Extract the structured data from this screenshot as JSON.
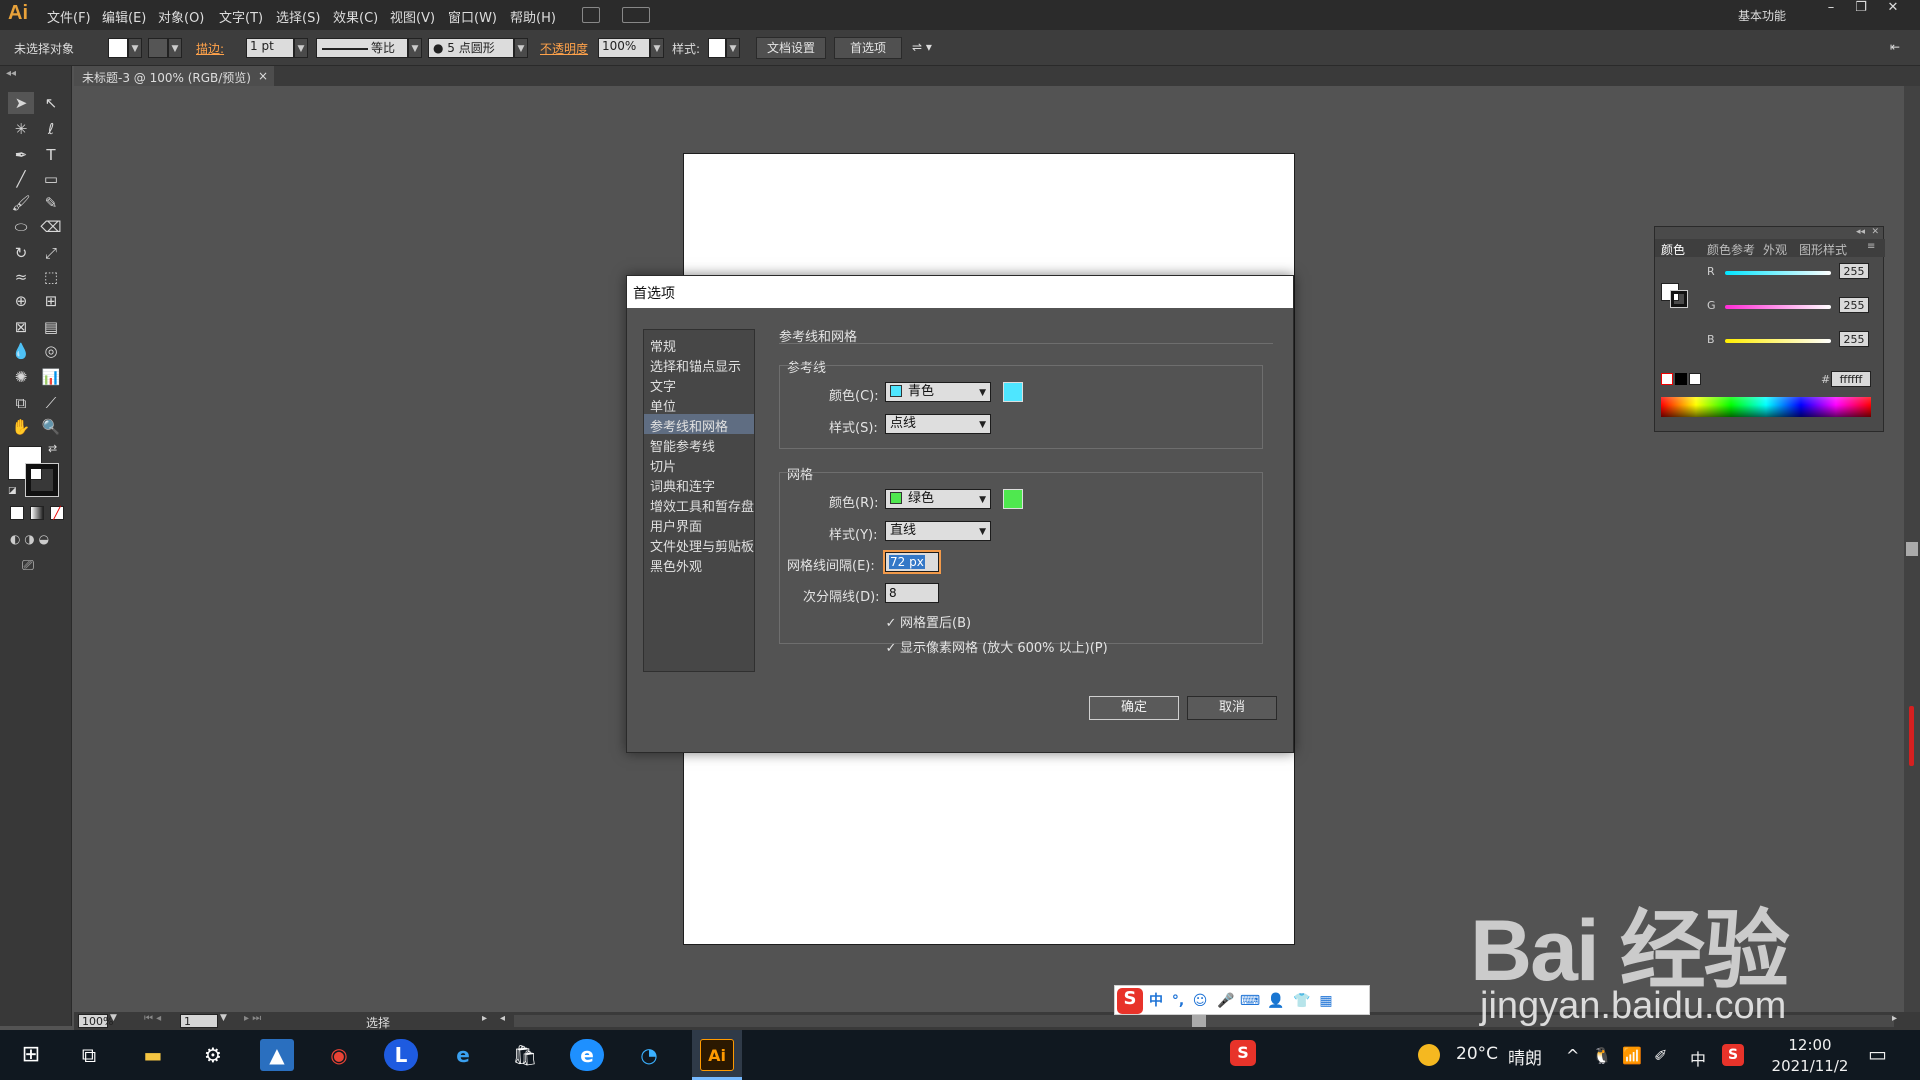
{
  "app": {
    "logo": "Ai"
  },
  "menu": [
    "文件(F)",
    "编辑(E)",
    "对象(O)",
    "文字(T)",
    "选择(S)",
    "效果(C)",
    "视图(V)",
    "窗口(W)",
    "帮助(H)"
  ],
  "workspace": {
    "label": "基本功能"
  },
  "controlbar": {
    "selection": "未选择对象",
    "stroke_label": "描边:",
    "stroke_value": "1 pt",
    "stroke_style": "等比",
    "brush": "● 5 点圆形",
    "opacity_label": "不透明度",
    "opacity_value": "100%",
    "style_label": "样式:",
    "doc_setup": "文档设置",
    "preferences": "首选项"
  },
  "tab": {
    "title": "未标题-3 @ 100% (RGB/预览)",
    "close": "×"
  },
  "status": {
    "zoom": "100%",
    "page": "1",
    "mode": "选择"
  },
  "color_panel": {
    "tabs": [
      "颜色",
      "颜色参考",
      "外观",
      "图形样式"
    ],
    "channels": [
      {
        "label": "R",
        "value": "255",
        "color": "#00e5ff"
      },
      {
        "label": "G",
        "value": "255",
        "color": "#ff2bd6"
      },
      {
        "label": "B",
        "value": "255",
        "color": "#ffee00"
      }
    ],
    "hex_label": "#",
    "hex_value": "ffffff"
  },
  "dialog": {
    "title": "首选项",
    "nav": [
      "常规",
      "选择和锚点显示",
      "文字",
      "单位",
      "参考线和网格",
      "智能参考线",
      "切片",
      "词典和连字",
      "增效工具和暂存盘",
      "用户界面",
      "文件处理与剪贴板",
      "黑色外观"
    ],
    "selected_nav": "参考线和网格",
    "section": "参考线和网格",
    "guides": {
      "title": "参考线",
      "color_label": "颜色(C):",
      "color_value": "青色",
      "color_hex": "#4ee6ff",
      "style_label": "样式(S):",
      "style_value": "点线"
    },
    "grid": {
      "title": "网格",
      "color_label": "颜色(R):",
      "color_value": "绿色",
      "color_hex": "#4fe84f",
      "style_label": "样式(Y):",
      "style_value": "直线",
      "spacing_label": "网格线间隔(E):",
      "spacing_value": "72 px",
      "subdiv_label": "次分隔线(D):",
      "subdiv_value": "8",
      "check_back": "网格置后(B)",
      "check_pixel": "显示像素网格 (放大 600% 以上)(P)"
    },
    "ok": "确定",
    "cancel": "取消"
  },
  "ime": {
    "lang": "中"
  },
  "watermark": {
    "logo": "Bai 经验",
    "url": "jingyan.baidu.com"
  },
  "taskbar": {
    "weather_temp": "20°C",
    "weather_text": "晴朗",
    "ime": "中",
    "time": "12:00",
    "date": "2021/11/2"
  }
}
